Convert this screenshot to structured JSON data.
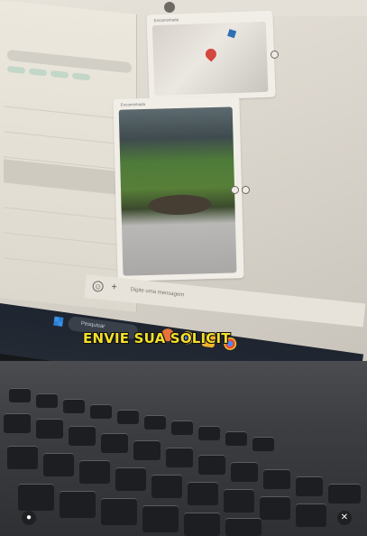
{
  "caption": {
    "text": "ENVIE SUA SOLICIT"
  },
  "chat": {
    "forwarded_label_1": "Encaminhada",
    "forwarded_label_2": "Encaminhada",
    "input_placeholder": "Digite uma mensagem"
  },
  "taskbar": {
    "search_label": "Pesquisar"
  },
  "overlay": {
    "user_icon": "user-icon",
    "mute_icon": "muted-speaker-icon"
  },
  "colors": {
    "caption": "#f3df2b",
    "taskbar": "#1f2530",
    "screen": "#e8e3da"
  }
}
